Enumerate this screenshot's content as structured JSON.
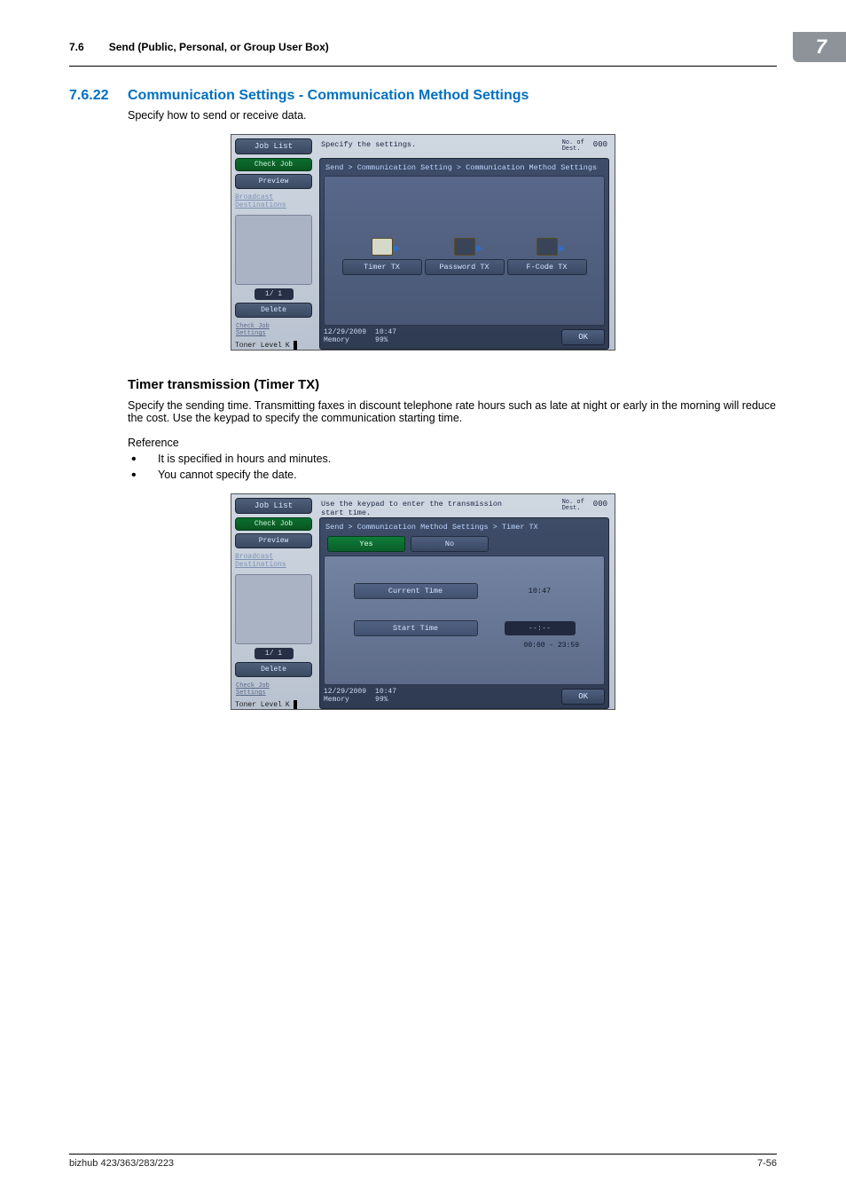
{
  "header": {
    "section_num": "7.6",
    "section_title": "Send (Public, Personal, or Group User Box)",
    "badge": "7"
  },
  "h2": {
    "num": "7.6.22",
    "title": "Communication Settings - Communication Method Settings"
  },
  "intro_text": "Specify how to send or receive data.",
  "h3_title": "Timer transmission (Timer TX)",
  "timer_text": "Specify the sending time. Transmitting faxes in discount telephone rate hours such as late at night or early in the morning will reduce the cost. Use the keypad to specify the communication starting time.",
  "reference_label": "Reference",
  "bullets": [
    "It is specified in hours and minutes.",
    "You cannot specify the date."
  ],
  "footer": {
    "left": "bizhub 423/363/283/223",
    "right": "7-56"
  },
  "ss1": {
    "left": {
      "job_list": "Job List",
      "check_job": "Check Job",
      "preview": "Preview",
      "broadcast": "Broadcast\nDestinations",
      "page": "1/  1",
      "delete": "Delete",
      "check_settings": "Check Job\nSettings",
      "toner": "Toner Level",
      "toner_k": "K"
    },
    "right": {
      "prompt": "Specify the settings.",
      "dest_label": "No. of\nDest.",
      "dest_count": "000",
      "crumb": "Send > Communication Setting  > Communication Method Settings",
      "icons": {
        "timer": "Timer TX",
        "password": "Password TX",
        "fcode": "F-Code TX"
      },
      "date": "12/29/2009",
      "time": "10:47",
      "memory_label": "Memory",
      "memory": "99%",
      "ok": "OK"
    }
  },
  "ss2": {
    "left": {
      "job_list": "Job List",
      "check_job": "Check Job",
      "preview": "Preview",
      "broadcast": "Broadcast\nDestinations",
      "page": "1/  1",
      "delete": "Delete",
      "check_settings": "Check Job\nSettings",
      "toner": "Toner Level",
      "toner_k": "K"
    },
    "right": {
      "prompt": "Use the keypad to enter the transmission\nstart time.",
      "dest_label": "No. of\nDest.",
      "dest_count": "000",
      "crumb": "Send > Communication Method Settings > Timer TX",
      "yes": "Yes",
      "no": "No",
      "current_time_label": "Current Time",
      "current_time_val": "10:47",
      "start_time_label": "Start Time",
      "start_time_val": "--:--",
      "range": "00:00  -  23:59",
      "date": "12/29/2009",
      "time": "10:47",
      "memory_label": "Memory",
      "memory": "99%",
      "ok": "OK"
    }
  }
}
